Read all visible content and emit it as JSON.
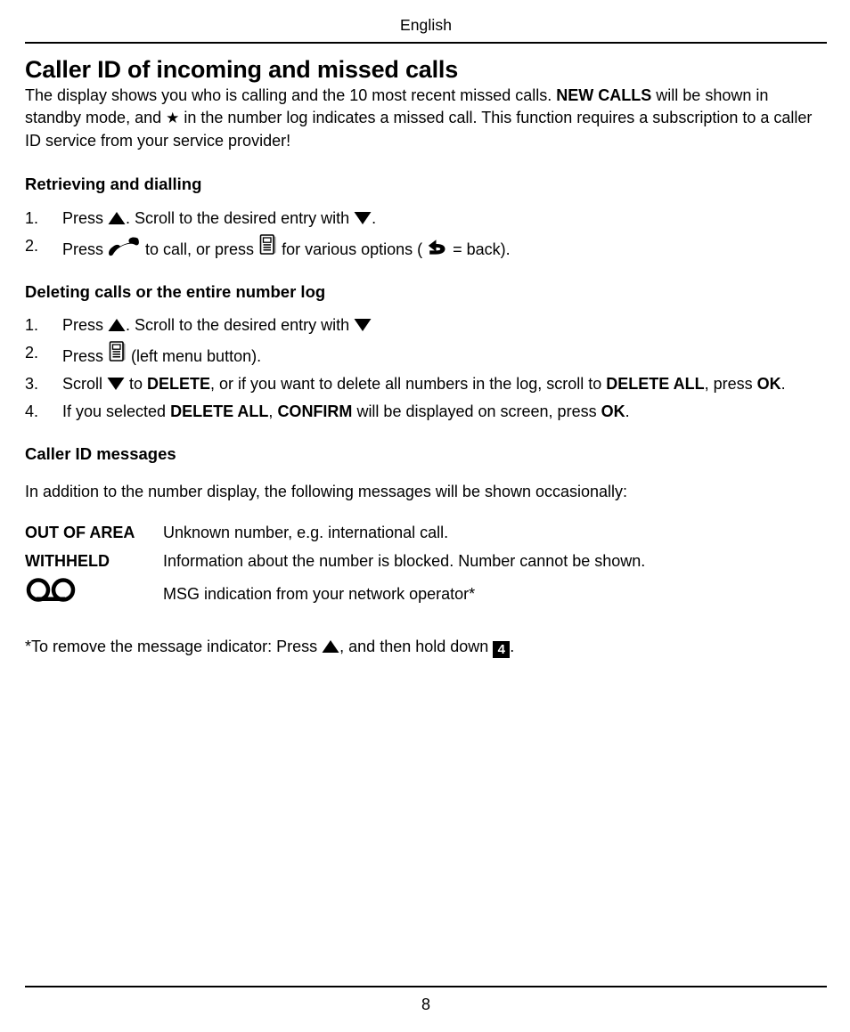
{
  "header": {
    "running_head": "English"
  },
  "title": "Caller ID of incoming and missed calls",
  "intro": {
    "part1": "The display shows you who is calling and the 10 most recent missed calls. ",
    "bold1": "NEW CALLS",
    "part2": " will be shown in standby mode, and ",
    "star_icon": "star-icon",
    "part3": " in the number log indicates a missed call. This function requires a subscription to a caller ID service from your service provider!"
  },
  "section_retrieving": {
    "heading": "Retrieving and dialling",
    "steps": [
      {
        "num": "1.",
        "part1": "Press ",
        "icon1": "triangle-up-icon",
        "part2": ". Scroll to the desired entry with ",
        "icon2": "triangle-down-icon",
        "part3": "."
      },
      {
        "num": "2.",
        "part1": "Press ",
        "icon1": "phone-handset-icon",
        "part2": " to call, or press ",
        "icon2": "menu-button-icon",
        "part3": " for various options ( ",
        "icon3": "back-arrow-icon",
        "part4": " = back)."
      }
    ]
  },
  "section_deleting": {
    "heading": "Deleting calls or the entire number log",
    "steps": [
      {
        "num": "1.",
        "part1": "Press ",
        "icon1": "triangle-up-icon",
        "part2": ". Scroll to the desired entry with ",
        "icon2": "triangle-down-icon",
        "part3": ""
      },
      {
        "num": "2.",
        "part1": "Press ",
        "icon1": "menu-button-icon",
        "part2": " (left menu button)."
      },
      {
        "num": "3.",
        "part1": "Scroll ",
        "icon1": "triangle-down-icon",
        "part2": " to ",
        "bold1": "DELETE",
        "part3": ", or if you want to delete all numbers in the log, scroll to ",
        "bold2": "DELETE ALL",
        "part4": ", press ",
        "bold3": "OK",
        "part5": "."
      },
      {
        "num": "4.",
        "part1": "If you selected ",
        "bold1": "DELETE ALL",
        "part2": ", ",
        "bold2": "CONFIRM",
        "part3": " will be displayed on screen, press ",
        "bold3": "OK",
        "part4": "."
      }
    ]
  },
  "section_messages": {
    "heading": "Caller ID messages",
    "intro": "In addition to the number display, the following messages will be shown occasionally:",
    "rows": [
      {
        "term": "OUT OF AREA",
        "term_is_icon": false,
        "desc": "Unknown number, e.g. international call."
      },
      {
        "term": "WITHHELD",
        "term_is_icon": false,
        "desc": "Information about the number is blocked. Number cannot be shown."
      },
      {
        "term": "answering-machine-icon",
        "term_is_icon": true,
        "desc": "MSG indication from your network operator*"
      }
    ]
  },
  "footnote": {
    "part1": "*To remove the message indicator: Press ",
    "icon1": "triangle-up-icon",
    "part2": ", and then hold down ",
    "key": "4",
    "part3": "."
  },
  "footer": {
    "page_number": "8"
  },
  "colors": {
    "text": "#000000",
    "background": "#ffffff",
    "rule": "#000000",
    "icon_shadow": "#9a9a9a"
  }
}
